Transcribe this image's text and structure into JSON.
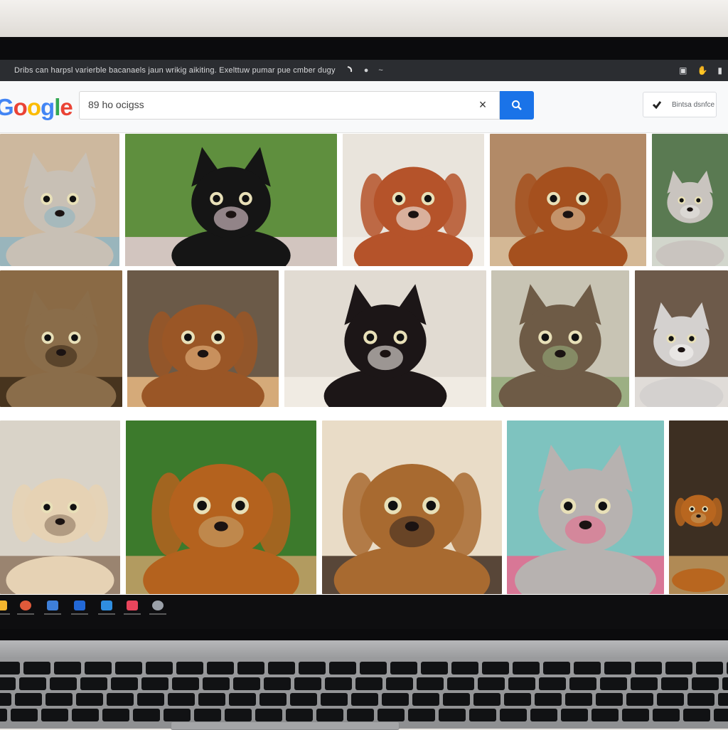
{
  "browser": {
    "url": "Dribs can harpsl varierble bacanaels jaun wrikig aikiting. Exelttuw pumar pue cmber dugy",
    "nav_icons": [
      "back-arrow-icon",
      "dot-icon",
      "tilde-icon"
    ],
    "right_icons": [
      "bookmark-icon",
      "extension-icon",
      "menu-icon"
    ]
  },
  "header": {
    "logo_letters": [
      "G",
      "o",
      "o",
      "g",
      "l",
      "e"
    ],
    "search_value": "89 ho ocigss",
    "clear_label": "×",
    "account_label": "Bintsa dsnfce"
  },
  "results": [
    {
      "subject": "grey kitten lying on blanket",
      "colors": {
        "bg": "#cdb89e",
        "animal": "#c8c0b5",
        "accent": "#8fb4c1"
      }
    },
    {
      "subject": "black and white cat on pink blanket",
      "colors": {
        "bg": "#5f8f3e",
        "animal": "#151515",
        "accent": "#e6cfd6"
      }
    },
    {
      "subject": "beagle puppy resting on white pillow",
      "colors": {
        "bg": "#e9e4dc",
        "animal": "#b5532a",
        "accent": "#f2efe9"
      }
    },
    {
      "subject": "brown puppy lying on rug",
      "colors": {
        "bg": "#b28a67",
        "animal": "#a5501e",
        "accent": "#d9c09d"
      }
    },
    {
      "subject": "grey kitten on couch",
      "colors": {
        "bg": "#5a7a52",
        "animal": "#c9c4bf",
        "accent": "#e8e6e2"
      }
    },
    {
      "subject": "tabby cat with green eyes",
      "colors": {
        "bg": "#8a6a45",
        "animal": "#8a6d4a",
        "accent": "#3b2a18"
      }
    },
    {
      "subject": "cocker spaniel puppy",
      "colors": {
        "bg": "#6b5a48",
        "animal": "#9a5626",
        "accent": "#e8b882"
      }
    },
    {
      "subject": "black kitten on fluffy blanket",
      "colors": {
        "bg": "#e1dbd2",
        "animal": "#1c1617",
        "accent": "#f2ede6"
      }
    },
    {
      "subject": "tabby kitten sitting on carpet",
      "colors": {
        "bg": "#c8c4b4",
        "animal": "#6e5b46",
        "accent": "#94ab7a"
      }
    },
    {
      "subject": "grey and white kitten",
      "colors": {
        "bg": "#6d5a4a",
        "animal": "#d4d1cf",
        "accent": "#f5f3f1"
      }
    },
    {
      "subject": "golden retriever puppy on cushion",
      "colors": {
        "bg": "#d9d3c8",
        "animal": "#e6d2b4",
        "accent": "#8e7660"
      }
    },
    {
      "subject": "dachshund puppy in wicker basket",
      "colors": {
        "bg": "#3c7a2c",
        "animal": "#b4621e",
        "accent": "#c7a16a"
      }
    },
    {
      "subject": "fluffy brown puppy",
      "colors": {
        "bg": "#e9dcc7",
        "animal": "#a86a30",
        "accent": "#3e2c1f"
      }
    },
    {
      "subject": "grey kitten sitting on floral rug",
      "colors": {
        "bg": "#7ec3bf",
        "animal": "#b7b2b0",
        "accent": "#e86a8e"
      }
    },
    {
      "subject": "puppy in basket partially visible",
      "colors": {
        "bg": "#3d2f22",
        "animal": "#b8661f",
        "accent": "#c49a5e"
      }
    }
  ],
  "taskbar": {
    "icons": [
      {
        "name": "windows-icon",
        "color": "#f5b52e"
      },
      {
        "name": "chrome-icon",
        "color": "#e05a3a"
      },
      {
        "name": "explorer-icon",
        "color": "#3e7fd8"
      },
      {
        "name": "edge-icon",
        "color": "#2268d6"
      },
      {
        "name": "store-icon",
        "color": "#2f8ee0"
      },
      {
        "name": "photos-icon",
        "color": "#e8455c"
      },
      {
        "name": "settings-icon",
        "color": "#9aa0a8"
      }
    ]
  }
}
